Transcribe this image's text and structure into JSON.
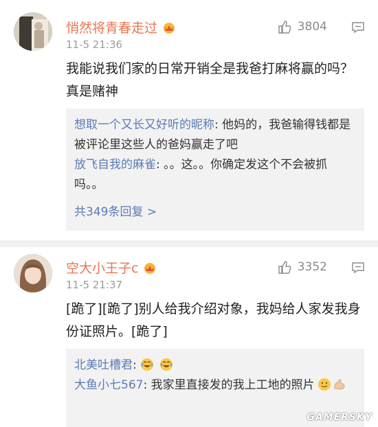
{
  "comments": [
    {
      "username": "悄然将青春走过",
      "time": "11-5 21:36",
      "likes": "3804",
      "text": "我能说我们家的日常开销全是我爸打麻将赢的吗？真是赌神",
      "avatar_icon": "user-avatar",
      "badge_icon": "vip-crown-icon",
      "replies": [
        {
          "name": "想取一个又长又好听的昵称",
          "text": ": 他妈的，我爸输得钱都是被评论里这些人的爸妈赢走了吧"
        },
        {
          "name": "放飞自我的麻雀",
          "text": ": 。。这。。你确定发这个不会被抓吗。。"
        }
      ],
      "more_replies": "共349条回复 >"
    },
    {
      "username": "空大小王子c",
      "time": "11-5 21:37",
      "likes": "3352",
      "text": "[跪了][跪了]别人给我介绍对象，我妈给人家发我身份证照片。[跪了]",
      "avatar_icon": "user-avatar",
      "badge_icon": "vip-crown-icon",
      "replies": [
        {
          "name": "北美吐槽君",
          "text": ":",
          "emojis": [
            "laugh-cry-emoji",
            "laugh-cry-emoji"
          ]
        },
        {
          "name": "大鱼小七567",
          "text": ": 我家里直接发的我上工地的照片",
          "emojis": [
            "smile-emoji",
            "muscle-emoji"
          ]
        }
      ]
    }
  ],
  "watermark": "GAMERSKY",
  "colors": {
    "username": "#eb7350",
    "reply_name": "#5b7bb5",
    "time": "#9b9b9b"
  }
}
